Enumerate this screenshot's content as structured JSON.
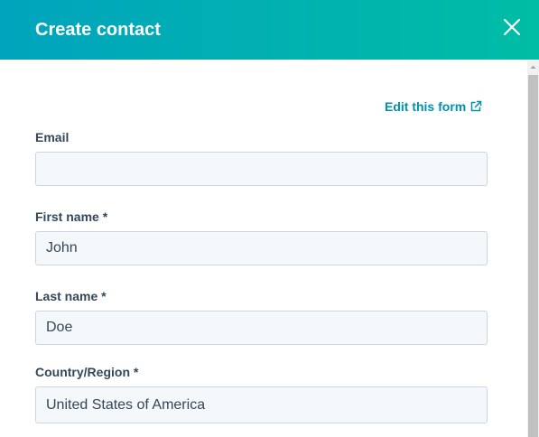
{
  "header": {
    "title": "Create contact",
    "close_icon": "close-icon"
  },
  "form": {
    "edit_link_label": "Edit this form",
    "edit_link_icon": "external-link-icon",
    "fields": [
      {
        "label": "Email",
        "value": ""
      },
      {
        "label": "First name *",
        "value": "John"
      },
      {
        "label": "Last name *",
        "value": "Doe"
      },
      {
        "label": "Country/Region *",
        "value": "United States of America"
      }
    ]
  },
  "colors": {
    "header_start": "#00a4bd",
    "header_end": "#00bda5",
    "link": "#0091ae",
    "label_text": "#33475b",
    "input_bg": "#f5f8fa",
    "input_border": "#cbd6e2"
  }
}
